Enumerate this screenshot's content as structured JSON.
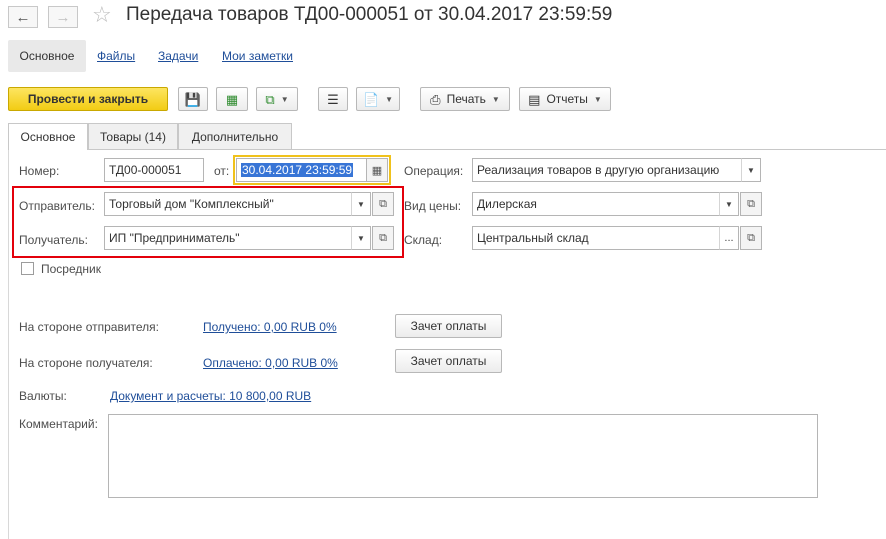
{
  "window": {
    "title": "Передача товаров ТД00-000051 от 30.04.2017 23:59:59"
  },
  "sections": [
    {
      "label": "Основное",
      "active": true
    },
    {
      "label": "Файлы"
    },
    {
      "label": "Задачи"
    },
    {
      "label": "Мои заметки"
    }
  ],
  "toolbar": {
    "post_close": "Провести и закрыть",
    "print": "Печать",
    "reports": "Отчеты",
    "icons": [
      "save-icon",
      "post-icon",
      "create-based-icon",
      "list-icon",
      "attach-icon",
      "printer-icon",
      "reports-icon"
    ]
  },
  "tabs": [
    {
      "label": "Основное",
      "active": true
    },
    {
      "label": "Товары (14)"
    },
    {
      "label": "Дополнительно"
    }
  ],
  "form": {
    "number_label": "Номер:",
    "number_value": "ТД00-000051",
    "date_label": "от:",
    "date_value": "30.04.2017 23:59:59",
    "operation_label": "Операция:",
    "operation_value": "Реализация товаров в другую организацию",
    "sender_label": "Отправитель:",
    "sender_value": "Торговый дом \"Комплексный\"",
    "price_type_label": "Вид цены:",
    "price_type_value": "Дилерская",
    "receiver_label": "Получатель:",
    "receiver_value": "ИП \"Предприниматель\"",
    "warehouse_label": "Склад:",
    "warehouse_value": "Центральный склад",
    "intermediary_label": "Посредник",
    "sender_side_label": "На стороне отправителя:",
    "sender_side_link": "Получено: 0,00 RUB  0%",
    "receiver_side_label": "На стороне получателя:",
    "receiver_side_link": "Оплачено: 0,00 RUB  0%",
    "offset_button": "Зачет оплаты",
    "currency_label": "Валюты:",
    "currency_link": "Документ и расчеты: 10 800,00 RUB",
    "comment_label": "Комментарий:",
    "ellipsis": "..."
  },
  "colors": {
    "primary_button": "#f2cc14",
    "link": "#1f4e99",
    "highlight_border": "#e3000b",
    "focus_border": "#f0c21c",
    "selection": "#3875d6"
  }
}
